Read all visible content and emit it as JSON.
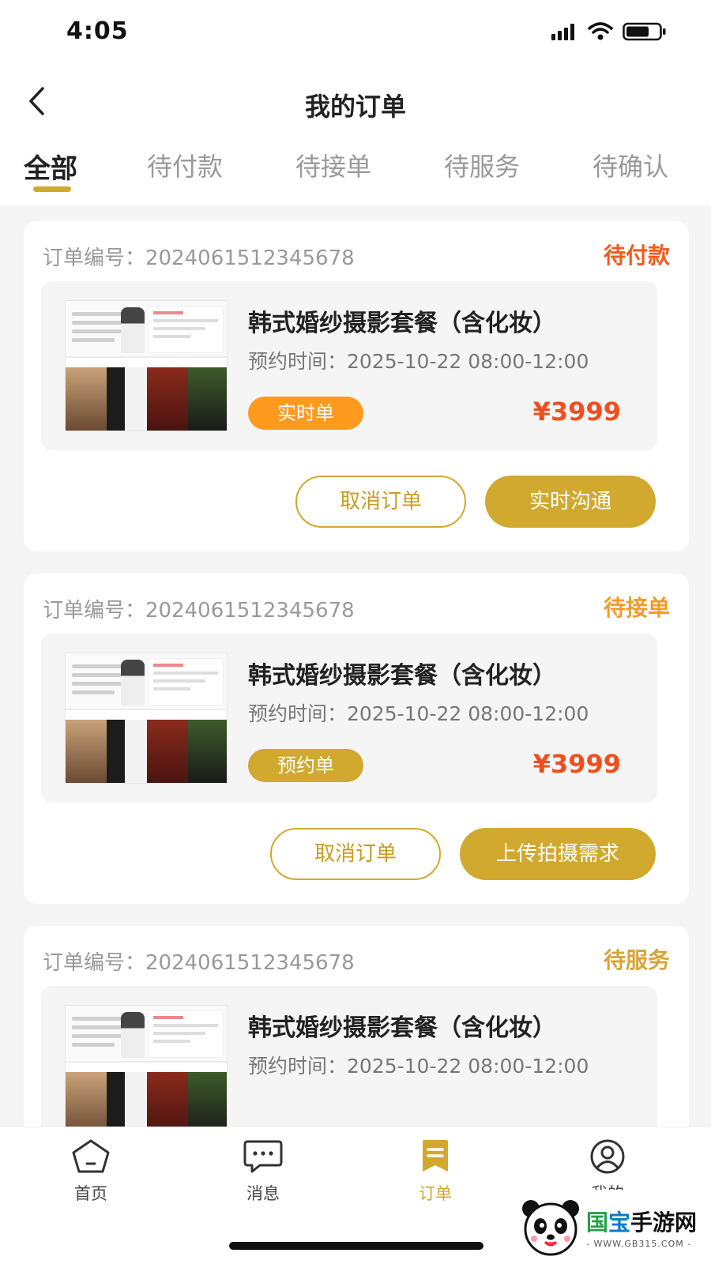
{
  "status": {
    "time": "4:05"
  },
  "header": {
    "title": "我的订单"
  },
  "tabs": [
    {
      "label": "全部",
      "active": true
    },
    {
      "label": "待付款"
    },
    {
      "label": "待接单"
    },
    {
      "label": "待服务"
    },
    {
      "label": "待确认"
    }
  ],
  "orders": [
    {
      "order_no": "订单编号：2024061512345678",
      "status": "待付款",
      "status_color": "#f05a1e",
      "title": "韩式婚纱摄影套餐（含化妆）",
      "time": "预约时间：2025-10-22 08:00-12:00",
      "type": "实时单",
      "type_color": "#ff9a1f",
      "price": "¥3999",
      "btn1": "取消订单",
      "btn2": "实时沟通"
    },
    {
      "order_no": "订单编号：2024061512345678",
      "status": "待接单",
      "status_color": "#f29b2b",
      "title": "韩式婚纱摄影套餐（含化妆）",
      "time": "预约时间：2025-10-22 08:00-12:00",
      "type": "预约单",
      "type_color": "#d1a92f",
      "price": "¥3999",
      "btn1": "取消订单",
      "btn2": "上传拍摄需求"
    },
    {
      "order_no": "订单编号：2024061512345678",
      "status": "待服务",
      "status_color": "#d6a53a",
      "title": "韩式婚纱摄影套餐（含化妆）",
      "time": "预约时间：2025-10-22 08:00-12:00"
    }
  ],
  "tabbar": [
    {
      "label": "首页",
      "icon": "home-icon"
    },
    {
      "label": "消息",
      "icon": "message-icon"
    },
    {
      "label": "订单",
      "icon": "order-icon",
      "active": true
    },
    {
      "label": "我的",
      "icon": "profile-icon"
    }
  ],
  "watermark": {
    "text_main_1": "国",
    "text_main_2": "宝",
    "text_main_3": "手游网",
    "text_sub": "- WWW.GB315.COM -"
  },
  "colors": {
    "accent": "#d1a92f",
    "price": "#f04e1e"
  }
}
